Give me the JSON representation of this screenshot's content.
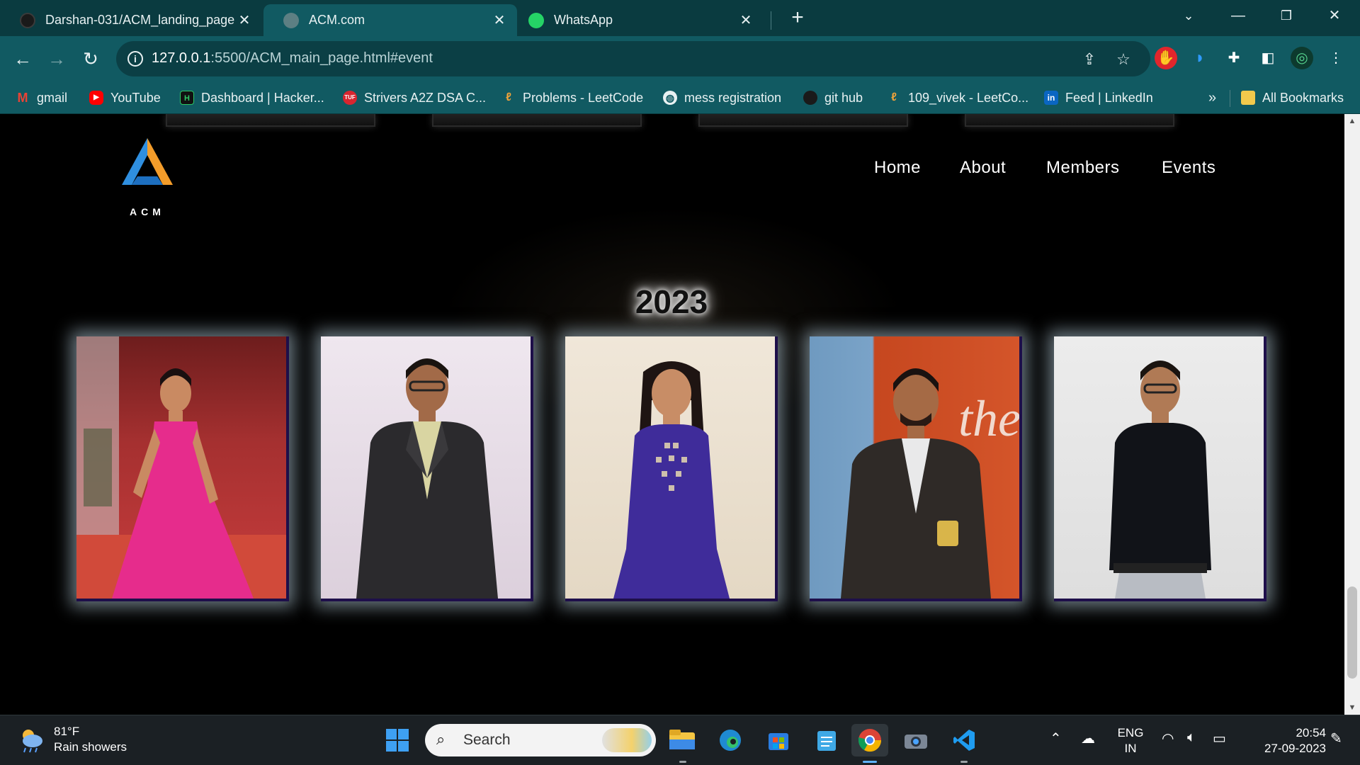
{
  "browser": {
    "tabs": [
      {
        "title": "Darshan-031/ACM_landing_page",
        "icon": "github-icon"
      },
      {
        "title": "ACM.com",
        "icon": "globe-icon"
      },
      {
        "title": "WhatsApp",
        "icon": "whatsapp-icon"
      }
    ],
    "url_host": "127.0.0.1",
    "url_path": ":5500/ACM_main_page.html#event",
    "bookmarks": [
      {
        "label": "gmail",
        "icon": "gmail-icon",
        "color": "#ea4335"
      },
      {
        "label": "YouTube",
        "icon": "youtube-icon",
        "color": "#ff0000"
      },
      {
        "label": "Dashboard | Hacker...",
        "icon": "hackerrank-icon",
        "color": "#111111"
      },
      {
        "label": "Strivers A2Z DSA C...",
        "icon": "tuf-icon",
        "color": "#d8252f"
      },
      {
        "label": "Problems - LeetCode",
        "icon": "leetcode-icon",
        "color": "#f0a33a"
      },
      {
        "label": "mess registration",
        "icon": "globe-icon",
        "color": "#e8f1f2"
      },
      {
        "label": "git hub",
        "icon": "github-icon",
        "color": "#e8f1f2"
      },
      {
        "label": "109_vivek - LeetCo...",
        "icon": "leetcode-icon",
        "color": "#f0a33a"
      },
      {
        "label": "Feed | LinkedIn",
        "icon": "linkedin-icon",
        "color": "#0a66c2"
      }
    ],
    "bookmarks_overflow": "»",
    "all_bookmarks": "All Bookmarks"
  },
  "page": {
    "logo_text": "ACM",
    "nav": [
      "Home",
      "About",
      "Members",
      "Events"
    ],
    "year": "2023",
    "members": [
      {
        "name": "member-photo-1",
        "bg": "#8a2a2a"
      },
      {
        "name": "member-photo-2",
        "bg": "#e6dfe6"
      },
      {
        "name": "member-photo-3",
        "bg": "#ece3d3"
      },
      {
        "name": "member-photo-4",
        "bg": "#c74a25"
      },
      {
        "name": "member-photo-5",
        "bg": "#e6e6e6"
      }
    ]
  },
  "taskbar": {
    "weather_temp": "81°F",
    "weather_desc": "Rain showers",
    "search_placeholder": "Search",
    "lang_top": "ENG",
    "lang_bottom": "IN",
    "time": "20:54",
    "date": "27-09-2023"
  },
  "colors": {
    "tab_bar": "#0a3b40",
    "toolbar": "#115a62",
    "card_border": "#1e0f4a",
    "card_glow": "#bed7e6"
  }
}
